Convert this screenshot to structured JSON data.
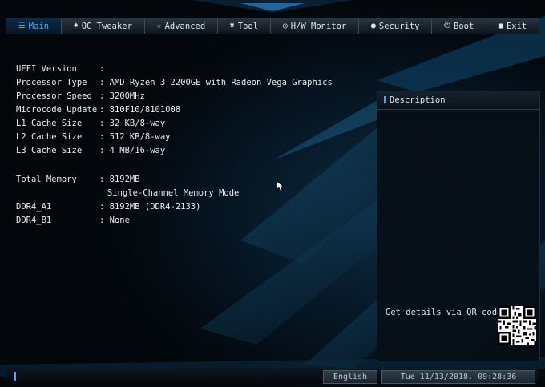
{
  "tabs": [
    {
      "label": "Main",
      "icon": "list-icon",
      "glyph": "☰",
      "active": true
    },
    {
      "label": "OC Tweaker",
      "icon": "flask-icon",
      "glyph": "♠",
      "active": false
    },
    {
      "label": "Advanced",
      "icon": "star-icon",
      "glyph": "☆",
      "active": false
    },
    {
      "label": "Tool",
      "icon": "wrench-icon",
      "glyph": "✖",
      "active": false
    },
    {
      "label": "H/W Monitor",
      "icon": "monitor-icon",
      "glyph": "◎",
      "active": false
    },
    {
      "label": "Security",
      "icon": "shield-icon",
      "glyph": "●",
      "active": false
    },
    {
      "label": "Boot",
      "icon": "power-icon",
      "glyph": "⏻",
      "active": false
    },
    {
      "label": "Exit",
      "icon": "exit-icon",
      "glyph": "■",
      "active": false
    }
  ],
  "info": {
    "uefi_version": {
      "label": "UEFI Version",
      "value": ":"
    },
    "processor_type": {
      "label": "Processor Type",
      "value": ": AMD Ryzen 3 2200GE with Radeon Vega Graphics"
    },
    "processor_speed": {
      "label": "Processor Speed",
      "value": ": 3200MHz"
    },
    "microcode_update": {
      "label": "Microcode Update",
      "value": ": 810F10/8101008"
    },
    "l1_cache": {
      "label": "L1 Cache Size",
      "value": ": 32 KB/8-way"
    },
    "l2_cache": {
      "label": "L2 Cache Size",
      "value": ": 512 KB/8-way"
    },
    "l3_cache": {
      "label": "L3 Cache Size",
      "value": ": 4 MB/16-way"
    },
    "total_memory": {
      "label": "Total Memory",
      "value": ": 8192MB"
    },
    "memory_mode": {
      "value": "Single-Channel Memory Mode"
    },
    "ddr4_a1": {
      "label": "DDR4_A1",
      "value": ": 8192MB (DDR4-2133)"
    },
    "ddr4_b1": {
      "label": "DDR4_B1",
      "value": ": None"
    }
  },
  "description": {
    "title": "Description",
    "qr_text": "Get details via QR code"
  },
  "status": {
    "language": "English",
    "datetime": "Tue 11/13/2018. 09:28:36"
  },
  "colors": {
    "accent": "#3fa9ff",
    "background": "#03070b"
  }
}
